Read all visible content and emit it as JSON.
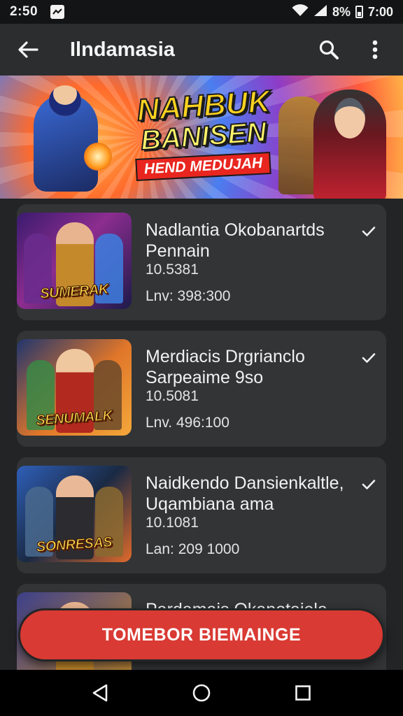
{
  "status_bar": {
    "time": "2:50",
    "battery_pct": "8%",
    "clock_right": "7:00",
    "icons": [
      "notification-icon",
      "wifi-icon",
      "signal-icon",
      "battery-icon"
    ]
  },
  "app_bar": {
    "title": "Ilndamasia",
    "icons": [
      "back-arrow-icon",
      "search-icon",
      "more-vert-icon"
    ]
  },
  "banner": {
    "line1": "NAHBUK",
    "line2": "BANISEN",
    "line3": "HEND MEDUJAH"
  },
  "games": [
    {
      "title_line1": "Nadlantia Okobanartds",
      "title_line2": "Pennain",
      "subtitle": "10.5381",
      "price": "Lnv: 398:300",
      "logo": "SUMERAK",
      "checked": true
    },
    {
      "title_line1": "Merdiacis Drgrianclo",
      "title_line2": "Sarpeaime 9so",
      "subtitle": "10.5081",
      "price": "Lnv. 496:100",
      "logo": "SENUMALK",
      "checked": true
    },
    {
      "title_line1": "Naidkendo Dansienkaltle,",
      "title_line2": "Uqambiana ama",
      "subtitle": "10.1081",
      "price": "Lan: 209 1000",
      "logo": "SONRESAS",
      "checked": true
    },
    {
      "title_line1": "Pardamais Okanotaiela",
      "title_line2": "",
      "subtitle": "",
      "price": "",
      "logo": "",
      "checked": false
    }
  ],
  "primary_button": {
    "label": "TOMEBOR BIEMAINGE"
  },
  "colors": {
    "accent": "#d93a33",
    "card_bg": "#323436",
    "app_bar_bg": "#2b2d2f",
    "page_bg": "#222426"
  }
}
